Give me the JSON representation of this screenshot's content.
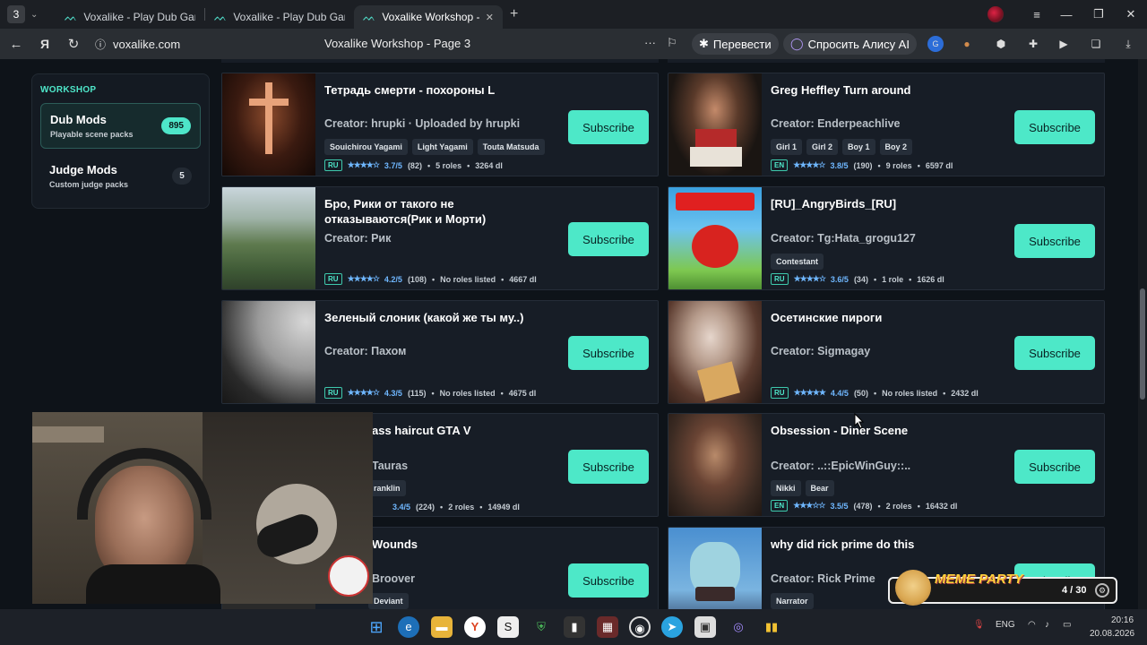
{
  "browser": {
    "tab_count": "3",
    "tabs": [
      {
        "label": "Voxalike - Play Dub Game"
      },
      {
        "label": "Voxalike - Play Dub Game"
      },
      {
        "label": "Voxalike Workshop - Pa"
      }
    ],
    "url": "voxalike.com",
    "page_title": "Voxalike Workshop - Page 3",
    "translate_label": "Перевести",
    "alice_label": "Спросить Алису AI"
  },
  "sidebar": {
    "heading": "WORKSHOP",
    "items": [
      {
        "name": "Dub Mods",
        "sub": "Playable scene packs",
        "count": "895"
      },
      {
        "name": "Judge Mods",
        "sub": "Custom judge packs",
        "count": "5"
      }
    ]
  },
  "subscribe_label": "Subscribe",
  "cards": [
    {
      "title": "Тетрадь смерти - похороны L",
      "creator": "Creator: hrupki · Uploaded by hrupki",
      "tags": [
        "Souichirou Yagami",
        "Light Yagami",
        "Touta Matsuda"
      ],
      "lang": "RU",
      "rating": "3.7/5",
      "votes": "(82)",
      "roles": "5 roles",
      "downloads": "3264 dl"
    },
    {
      "title": "Greg Heffley Turn around",
      "creator": "Creator: Enderpeachlive",
      "tags": [
        "Girl 1",
        "Girl 2",
        "Boy 1",
        "Boy 2"
      ],
      "lang": "EN",
      "rating": "3.8/5",
      "votes": "(190)",
      "roles": "9 roles",
      "downloads": "6597 dl"
    },
    {
      "title": "Бро, Рики от такого не отказываются(Рик и Морти)",
      "creator": "Creator: Рик",
      "tags": [],
      "lang": "RU",
      "rating": "4.2/5",
      "votes": "(108)",
      "roles": "No roles listed",
      "downloads": "4667 dl"
    },
    {
      "title": "[RU]_AngryBirds_[RU]",
      "creator": "Creator: Tg:Hata_grogu127",
      "tags": [
        "Contestant"
      ],
      "lang": "RU",
      "rating": "3.6/5",
      "votes": "(34)",
      "roles": "1 role",
      "downloads": "1626 dl"
    },
    {
      "title": "Зеленый слоник (какой же ты му..)",
      "creator": "Creator: Пахом",
      "tags": [],
      "lang": "RU",
      "rating": "4.3/5",
      "votes": "(115)",
      "roles": "No roles listed",
      "downloads": "4675 dl"
    },
    {
      "title": "Осетинские пироги",
      "creator": "Creator: Sigmagay",
      "tags": [],
      "lang": "RU",
      "rating": "4.4/5",
      "votes": "(50)",
      "roles": "No roles listed",
      "downloads": "2432 dl"
    },
    {
      "title": "ass haircut GTA V",
      "creator": "Tauras",
      "tags": [
        "ranklin"
      ],
      "lang": "",
      "rating": "3.4/5",
      "votes": "(224)",
      "roles": "2 roles",
      "downloads": "14949 dl"
    },
    {
      "title": "Obsession - Diner Scene",
      "creator": "Creator: ..::EpicWinGuy::..",
      "tags": [
        "Nikki",
        "Bear"
      ],
      "lang": "EN",
      "rating": "3.5/5",
      "votes": "(478)",
      "roles": "2 roles",
      "downloads": "16432 dl"
    },
    {
      "title": "Wounds",
      "creator": "Broover",
      "tags": [
        "Deviant"
      ],
      "lang": "",
      "rating": "",
      "votes": "",
      "roles": "",
      "downloads": ""
    },
    {
      "title": "why did rick prime do this",
      "creator": "Creator: Rick Prime",
      "tags": [
        "Narrator"
      ],
      "lang": "",
      "rating": "",
      "votes": "",
      "roles": "",
      "downloads": ""
    }
  ],
  "overlay": {
    "badge_text": "MEME PARTY",
    "badge_count": "4 / 30"
  },
  "taskbar": {
    "lang": "ENG",
    "time": "20:16",
    "date": "20.08.2026"
  }
}
